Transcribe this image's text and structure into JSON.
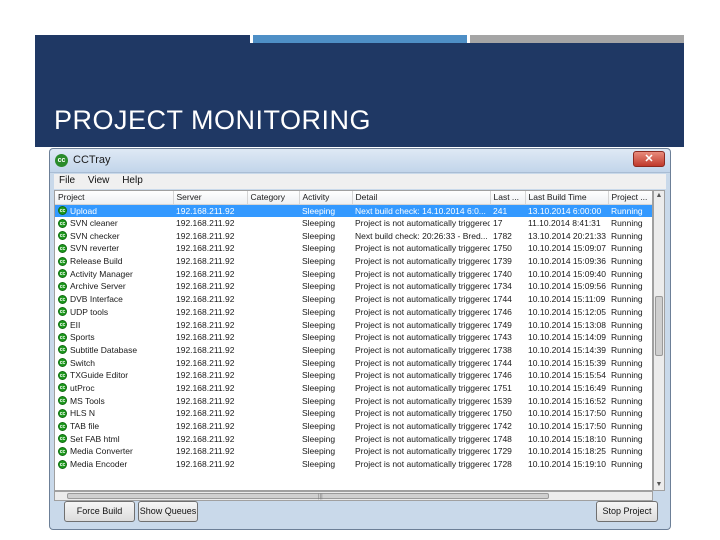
{
  "slide": {
    "title": "PROJECT MONITORING"
  },
  "colors": {
    "band": "#1f3864",
    "accent_mid": "#4e8fc6",
    "accent_light": "#a5a5a5",
    "selection": "#3399ff",
    "status_ok": "#1e9a1e"
  },
  "window": {
    "app_icon": "cc-icon",
    "title": "CCTray",
    "close_symbol": "✕",
    "menu": [
      "File",
      "View",
      "Help"
    ],
    "columns": [
      "Project",
      "Server",
      "Category",
      "Activity",
      "Detail",
      "Last ...",
      "Last Build Time",
      "Project ..."
    ],
    "rows": [
      {
        "project": "Upload",
        "server": "192.168.211.92",
        "category": "",
        "activity": "Sleeping",
        "detail": "Next build check: 14.10.2014 6:0...",
        "last": "241",
        "time": "13.10.2014 6:00:00",
        "status": "Running",
        "selected": true
      },
      {
        "project": "SVN cleaner",
        "server": "192.168.211.92",
        "category": "",
        "activity": "Sleeping",
        "detail": "Project is not automatically triggered",
        "last": "17",
        "time": "11.10.2014 8:41:31",
        "status": "Running"
      },
      {
        "project": "SVN checker",
        "server": "192.168.211.92",
        "category": "",
        "activity": "Sleeping",
        "detail": "Next build check: 20:26:33 - Bred...",
        "last": "1782",
        "time": "13.10.2014 20:21:33",
        "status": "Running"
      },
      {
        "project": "SVN reverter",
        "server": "192.168.211.92",
        "category": "",
        "activity": "Sleeping",
        "detail": "Project is not automatically triggered",
        "last": "1750",
        "time": "10.10.2014 15:09:07",
        "status": "Running"
      },
      {
        "project": "Release Build",
        "server": "192.168.211.92",
        "category": "",
        "activity": "Sleeping",
        "detail": "Project is not automatically triggered",
        "last": "1739",
        "time": "10.10.2014 15:09:36",
        "status": "Running"
      },
      {
        "project": "Activity Manager",
        "server": "192.168.211.92",
        "category": "",
        "activity": "Sleeping",
        "detail": "Project is not automatically triggered",
        "last": "1740",
        "time": "10.10.2014 15:09:40",
        "status": "Running"
      },
      {
        "project": "Archive Server",
        "server": "192.168.211.92",
        "category": "",
        "activity": "Sleeping",
        "detail": "Project is not automatically triggered",
        "last": "1734",
        "time": "10.10.2014 15:09:56",
        "status": "Running"
      },
      {
        "project": "DVB Interface",
        "server": "192.168.211.92",
        "category": "",
        "activity": "Sleeping",
        "detail": "Project is not automatically triggered",
        "last": "1744",
        "time": "10.10.2014 15:11:09",
        "status": "Running"
      },
      {
        "project": "UDP tools",
        "server": "192.168.211.92",
        "category": "",
        "activity": "Sleeping",
        "detail": "Project is not automatically triggered",
        "last": "1746",
        "time": "10.10.2014 15:12:05",
        "status": "Running"
      },
      {
        "project": "EII",
        "server": "192.168.211.92",
        "category": "",
        "activity": "Sleeping",
        "detail": "Project is not automatically triggered",
        "last": "1749",
        "time": "10.10.2014 15:13:08",
        "status": "Running"
      },
      {
        "project": "Sports",
        "server": "192.168.211.92",
        "category": "",
        "activity": "Sleeping",
        "detail": "Project is not automatically triggered",
        "last": "1743",
        "time": "10.10.2014 15:14:09",
        "status": "Running"
      },
      {
        "project": "Subtitle Database",
        "server": "192.168.211.92",
        "category": "",
        "activity": "Sleeping",
        "detail": "Project is not automatically triggered",
        "last": "1738",
        "time": "10.10.2014 15:14:39",
        "status": "Running"
      },
      {
        "project": "Switch",
        "server": "192.168.211.92",
        "category": "",
        "activity": "Sleeping",
        "detail": "Project is not automatically triggered",
        "last": "1744",
        "time": "10.10.2014 15:15:39",
        "status": "Running"
      },
      {
        "project": "TXGuide Editor",
        "server": "192.168.211.92",
        "category": "",
        "activity": "Sleeping",
        "detail": "Project is not automatically triggered",
        "last": "1746",
        "time": "10.10.2014 15:15:54",
        "status": "Running"
      },
      {
        "project": "utProc",
        "server": "192.168.211.92",
        "category": "",
        "activity": "Sleeping",
        "detail": "Project is not automatically triggered",
        "last": "1751",
        "time": "10.10.2014 15:16:49",
        "status": "Running"
      },
      {
        "project": "MS Tools",
        "server": "192.168.211.92",
        "category": "",
        "activity": "Sleeping",
        "detail": "Project is not automatically triggered",
        "last": "1539",
        "time": "10.10.2014 15:16:52",
        "status": "Running"
      },
      {
        "project": "HLS N",
        "server": "192.168.211.92",
        "category": "",
        "activity": "Sleeping",
        "detail": "Project is not automatically triggered",
        "last": "1750",
        "time": "10.10.2014 15:17:50",
        "status": "Running"
      },
      {
        "project": "TAB file",
        "server": "192.168.211.92",
        "category": "",
        "activity": "Sleeping",
        "detail": "Project is not automatically triggered",
        "last": "1742",
        "time": "10.10.2014 15:17:50",
        "status": "Running"
      },
      {
        "project": "Set FAB html",
        "server": "192.168.211.92",
        "category": "",
        "activity": "Sleeping",
        "detail": "Project is not automatically triggered",
        "last": "1748",
        "time": "10.10.2014 15:18:10",
        "status": "Running"
      },
      {
        "project": "Media Converter",
        "server": "192.168.211.92",
        "category": "",
        "activity": "Sleeping",
        "detail": "Project is not automatically triggered",
        "last": "1729",
        "time": "10.10.2014 15:18:25",
        "status": "Running"
      },
      {
        "project": "Media Encoder",
        "server": "192.168.211.92",
        "category": "",
        "activity": "Sleeping",
        "detail": "Project is not automatically triggered",
        "last": "1728",
        "time": "10.10.2014 15:19:10",
        "status": "Running"
      }
    ],
    "buttons": {
      "force_build": "Force Build",
      "show_queues": "Show Queues",
      "stop_project": "Stop Project"
    },
    "scroll": {
      "up": "▲",
      "down": "▼",
      "grip": "|||"
    }
  }
}
